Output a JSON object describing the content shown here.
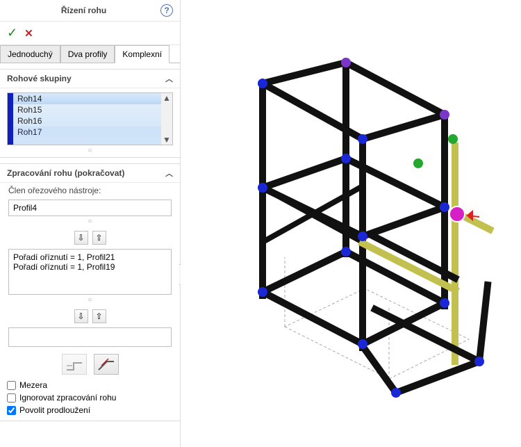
{
  "header": {
    "title": "Řízení rohu"
  },
  "tabs": [
    "Jednoduchý",
    "Dva profily",
    "Komplexní"
  ],
  "active_tab": 2,
  "section_groups": {
    "title": "Rohové skupiny",
    "items": [
      "Roh14",
      "Roh15",
      "Roh16",
      "Roh17"
    ]
  },
  "section_process": {
    "title": "Zpracování rohu (pokračovat)",
    "member_label": "Člen ořezového nástroje:",
    "member_value": "Profil4",
    "order_items": [
      "Pořadí oříznutí = 1, Profil21",
      "Pořadí oříznutí = 1, Profil19"
    ]
  },
  "checks": {
    "gap": "Mezera",
    "ignore": "Ignorovat zpracování rohu",
    "allow_extend": "Povolit prodloužení"
  },
  "check_states": {
    "gap": false,
    "ignore": false,
    "allow_extend": true
  },
  "icons": {
    "help": "?",
    "ok": "✓",
    "cancel": "✕",
    "up": "▲",
    "down": "▼",
    "arrow_down": "⇩",
    "arrow_up": "⇧",
    "move_up": "↑",
    "move_down": "↓"
  },
  "viewport": {
    "accent_color": "#c2c04f",
    "highlight_node": "#d61fc4",
    "node_full": "#1a27d6",
    "node_partial": "#7a36c8",
    "node_open": "#23a82f"
  }
}
